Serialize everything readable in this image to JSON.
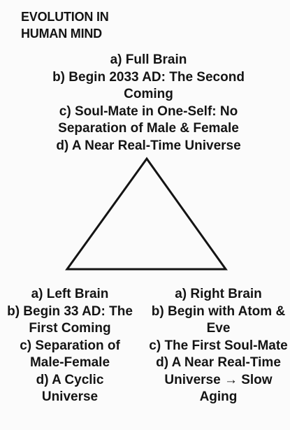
{
  "title_lines": [
    "EVOLUTION IN",
    "HUMAN MIND"
  ],
  "top": [
    "a) Full Brain",
    "b) Begin 2033 AD: The Second",
    "Coming",
    "c) Soul-Mate in One-Self: No",
    "Separation of Male & Female",
    "d) A Near Real-Time Universe"
  ],
  "bottom_left": [
    "a) Left Brain",
    "b) Begin 33 AD: The",
    "First Coming",
    "c) Separation of",
    "Male-Female",
    "d) A Cyclic",
    "Universe"
  ],
  "bottom_right": [
    "a) Right Brain",
    "b) Begin with Atom &",
    "Eve",
    "c) The First Soul-Mate",
    "d) A Near Real-Time",
    "Universe → Slow",
    "Aging"
  ]
}
